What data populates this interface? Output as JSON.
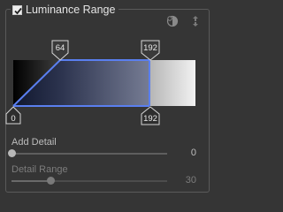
{
  "panel": {
    "title": "Luminance Range",
    "enabled": true
  },
  "icons": {
    "left": "layers-mask-icon",
    "right": "reset-arrows-icon"
  },
  "graph": {
    "markers": {
      "top_left": "64",
      "top_right": "192",
      "bottom_left": "0",
      "bottom_right": "192"
    }
  },
  "controls": {
    "add_detail": {
      "label": "Add Detail",
      "value": "0",
      "position": 0.0,
      "enabled": true
    },
    "detail_range": {
      "label": "Detail Range",
      "value": "30",
      "position": 0.25,
      "enabled": false
    }
  },
  "colors": {
    "background": "#353535",
    "curve": "#5a7ff0",
    "dark_fill": "#1e2640"
  }
}
